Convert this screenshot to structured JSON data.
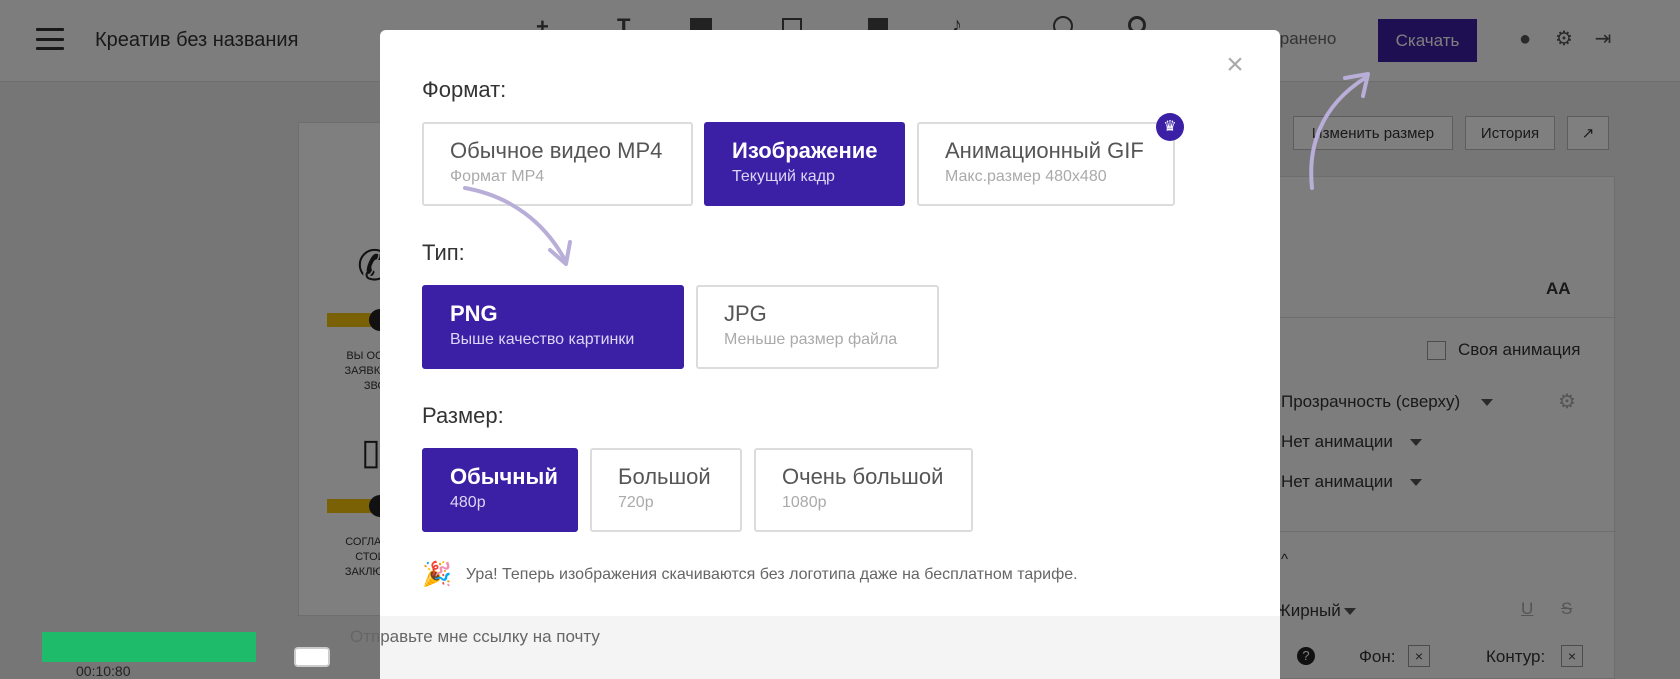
{
  "editor": {
    "title": "Креатив без названия",
    "saved_status": "охранено",
    "download_label": "Скачать",
    "timecode": "00:10:80",
    "canvas": {
      "text1_line1": "ВЫ ОСТАВ",
      "text1_line2": "ЗАЯВКУ НА",
      "text1_line3": "ЗВО",
      "text2_line1": "СОГЛАСОВ",
      "text2_line2": "СТОИМ",
      "text2_line3": "ЗАКЛЮЧАЕ"
    },
    "right_panel": {
      "resize_label": "Изменить размер",
      "history_label": "История",
      "aa_label": "AA",
      "custom_anim_label": "Своя анимация",
      "transparency_label": "Прозрачность (сверху)",
      "no_anim_1": "Нет анимации",
      "no_anim_2": "Нет анимации",
      "bold_label": "Жирный",
      "bg_label": "Фон:",
      "outline_label": "Контур:"
    }
  },
  "modal": {
    "format_label": "Формат:",
    "formats": [
      {
        "title": "Обычное видео MP4",
        "subtitle": "Формат MP4"
      },
      {
        "title": "Изображение",
        "subtitle": "Текущий кадр"
      },
      {
        "title": "Анимационный GIF",
        "subtitle": "Макс.размер 480х480"
      }
    ],
    "type_label": "Тип:",
    "types": [
      {
        "title": "PNG",
        "subtitle": "Выше качество картинки"
      },
      {
        "title": "JPG",
        "subtitle": "Меньше размер файла"
      }
    ],
    "size_label": "Размер:",
    "sizes": [
      {
        "title": "Обычный",
        "subtitle": "480p"
      },
      {
        "title": "Большой",
        "subtitle": "720p"
      },
      {
        "title": "Очень большой",
        "subtitle": "1080p"
      }
    ],
    "notice": "Ура! Теперь изображения скачиваются без логотипа даже на бесплатном тарифе.",
    "email_label": "Отправьте мне ссылку на почту",
    "close_symbol": "×"
  },
  "icons": {
    "trophy": "trophy-icon",
    "party": "party-popper-icon",
    "arrow_color": "#b8aed8"
  },
  "colors": {
    "accent": "#3b1fa5",
    "go_button": "#1dbb6a"
  }
}
